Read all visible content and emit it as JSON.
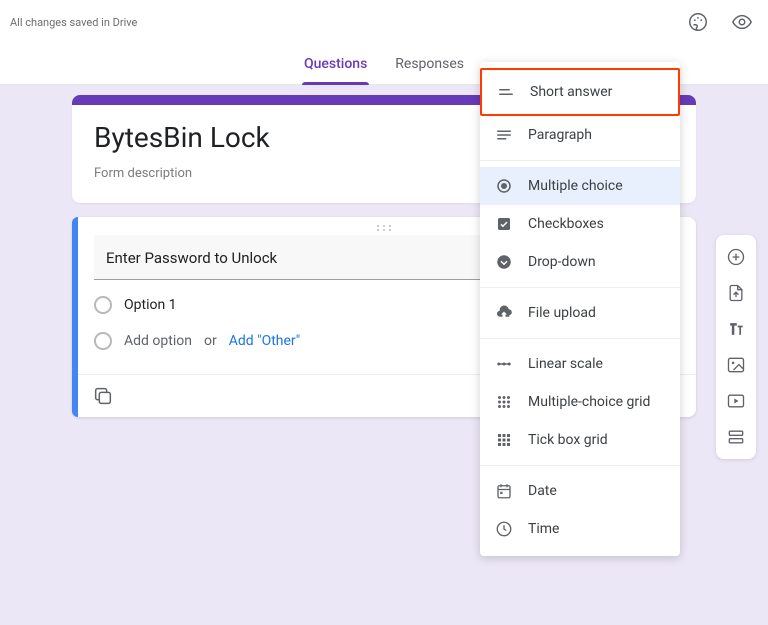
{
  "topbar": {
    "save_status": "All changes saved in Drive"
  },
  "tabs": {
    "questions": "Questions",
    "responses": "Responses"
  },
  "form": {
    "title": "BytesBin Lock",
    "description_placeholder": "Form description"
  },
  "question": {
    "title": "Enter Password to Unlock",
    "option1": "Option 1",
    "add_option": "Add option",
    "or": "or",
    "add_other": "Add \"Other\""
  },
  "qtype_menu": {
    "items": [
      {
        "key": "short_answer",
        "label": "Short answer",
        "group": 0
      },
      {
        "key": "paragraph",
        "label": "Paragraph",
        "group": 0
      },
      {
        "key": "multiple_choice",
        "label": "Multiple choice",
        "group": 1,
        "selected": true
      },
      {
        "key": "checkboxes",
        "label": "Checkboxes",
        "group": 1
      },
      {
        "key": "dropdown",
        "label": "Drop-down",
        "group": 1
      },
      {
        "key": "file_upload",
        "label": "File upload",
        "group": 2
      },
      {
        "key": "linear_scale",
        "label": "Linear scale",
        "group": 3
      },
      {
        "key": "mc_grid",
        "label": "Multiple-choice grid",
        "group": 3
      },
      {
        "key": "tick_grid",
        "label": "Tick box grid",
        "group": 3
      },
      {
        "key": "date",
        "label": "Date",
        "group": 4
      },
      {
        "key": "time",
        "label": "Time",
        "group": 4
      }
    ]
  },
  "colors": {
    "accent": "#673ab7",
    "highlight": "#ff3b00",
    "link": "#1a73e8"
  }
}
